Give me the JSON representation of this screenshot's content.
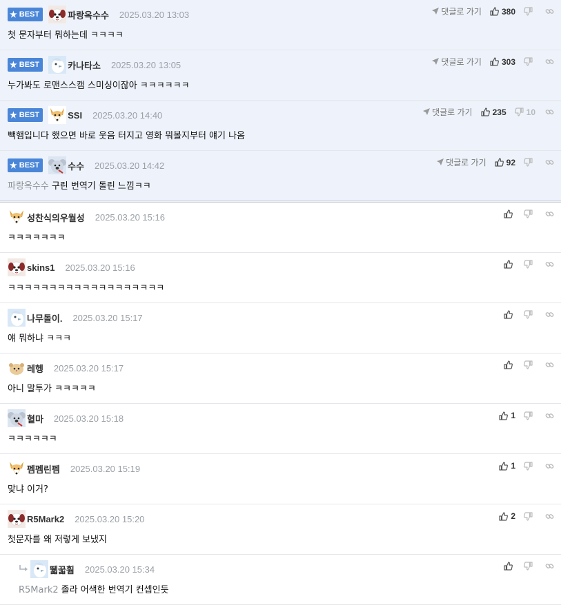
{
  "best_label": "BEST",
  "goto_label": "댓글로 가기",
  "comments": [
    {
      "best": true,
      "nick": "파랑옥수수",
      "time": "2025.03.20 13:03",
      "text": "첫 문자부터 뭐하는데 ㅋㅋㅋㅋ",
      "likes": "380",
      "dislikes": "",
      "avatar": "dog"
    },
    {
      "best": true,
      "nick": "카나타소",
      "time": "2025.03.20 13:05",
      "text": "누가봐도 로맨스스캠 스미싱이잖아 ㅋㅋㅋㅋㅋㅋ",
      "likes": "303",
      "dislikes": "",
      "avatar": "bird"
    },
    {
      "best": true,
      "nick": "SSI",
      "time": "2025.03.20 14:40",
      "text": "빽햄입니다 했으면 바로 웃음 터지고 영화 뭐볼지부터 얘기 나옴",
      "likes": "235",
      "dislikes": "10",
      "avatar": "fox"
    },
    {
      "best": true,
      "nick": "수수",
      "time": "2025.03.20 14:42",
      "reply_to": "파랑옥수수",
      "text": "구린 번역기 돌린 느낌ㅋㅋ",
      "likes": "92",
      "dislikes": "",
      "avatar": "koala"
    },
    {
      "best": false,
      "nick": "성찬식의우월성",
      "time": "2025.03.20 15:16",
      "text": "ㅋㅋㅋㅋㅋㅋㅋ",
      "likes": "",
      "dislikes": "",
      "avatar": "fox"
    },
    {
      "best": false,
      "nick": "skins1",
      "time": "2025.03.20 15:16",
      "text": "ㅋㅋㅋㅋㅋㅋㅋㅋㅋㅋㅋㅋㅋㅋㅋㅋㅋㅋㅋ",
      "likes": "",
      "dislikes": "",
      "avatar": "dog"
    },
    {
      "best": false,
      "nick": "나무돌이.",
      "time": "2025.03.20 15:17",
      "text": "얘 뭐하냐 ㅋㅋㅋ",
      "likes": "",
      "dislikes": "",
      "avatar": "bird"
    },
    {
      "best": false,
      "nick": "레헹",
      "time": "2025.03.20 15:17",
      "text": "아니 말투가 ㅋㅋㅋㅋㅋ",
      "likes": "",
      "dislikes": "",
      "avatar": "hamster"
    },
    {
      "best": false,
      "nick": "혈마",
      "time": "2025.03.20 15:18",
      "text": "ㅋㅋㅋㅋㅋㅋ",
      "likes": "1",
      "dislikes": "",
      "avatar": "koala"
    },
    {
      "best": false,
      "nick": "펨펨린펨",
      "time": "2025.03.20 15:19",
      "text": "맞냐 이거?",
      "likes": "1",
      "dislikes": "",
      "avatar": "fox"
    },
    {
      "best": false,
      "nick": "R5Mark2",
      "time": "2025.03.20 15:20",
      "text": "첫문자를 왜 저렇게 보냈지",
      "likes": "2",
      "dislikes": "",
      "avatar": "dog"
    },
    {
      "best": false,
      "reply": true,
      "nick": "뛟꿃훰",
      "time": "2025.03.20 15:34",
      "reply_to": "R5Mark2",
      "text": "졸라 어색한 번역기 컨셉인듯",
      "likes": "",
      "dislikes": "",
      "avatar": "bird"
    }
  ]
}
